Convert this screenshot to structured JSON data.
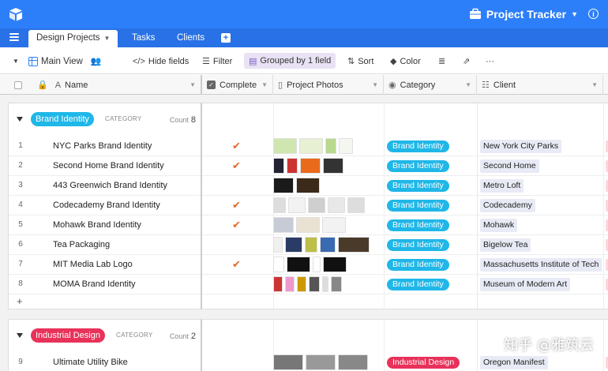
{
  "app": {
    "title": "Project Tracker",
    "brand_color": "#2d7ff9",
    "tabbar_color": "#2871e6"
  },
  "tabs": [
    {
      "label": "Design Projects",
      "active": true
    },
    {
      "label": "Tasks",
      "active": false
    },
    {
      "label": "Clients",
      "active": false
    }
  ],
  "viewbar": {
    "view_name": "Main View",
    "hide_fields": "Hide fields",
    "filter": "Filter",
    "grouped": "Grouped by 1 field",
    "sort": "Sort",
    "color": "Color",
    "more": "···"
  },
  "columns": {
    "name": "Name",
    "complete": "Complete",
    "photos": "Project Photos",
    "category": "Category",
    "client": "Client"
  },
  "groups": [
    {
      "label": "Brand Identity",
      "category_tag": "CATEGORY",
      "count_label": "Count",
      "count": "8",
      "color": "#1fb7e8",
      "rows": [
        {
          "num": "1",
          "name": "NYC Parks Brand Identity",
          "complete": true,
          "category": "Brand Identity",
          "client": "New York City Parks"
        },
        {
          "num": "2",
          "name": "Second Home Brand Identity",
          "complete": true,
          "category": "Brand Identity",
          "client": "Second Home"
        },
        {
          "num": "3",
          "name": "443 Greenwich Brand Identity",
          "complete": false,
          "category": "Brand Identity",
          "client": "Metro Loft"
        },
        {
          "num": "4",
          "name": "Codecademy Brand Identity",
          "complete": true,
          "category": "Brand Identity",
          "client": "Codecademy"
        },
        {
          "num": "5",
          "name": "Mohawk Brand Identity",
          "complete": true,
          "category": "Brand Identity",
          "client": "Mohawk"
        },
        {
          "num": "6",
          "name": "Tea Packaging",
          "complete": false,
          "category": "Brand Identity",
          "client": "Bigelow Tea"
        },
        {
          "num": "7",
          "name": "MIT Media Lab Logo",
          "complete": true,
          "category": "Brand Identity",
          "client": "Massachusetts Institute of Tech"
        },
        {
          "num": "8",
          "name": "MOMA Brand Identity",
          "complete": false,
          "category": "Brand Identity",
          "client": "Museum of Modern Art"
        }
      ]
    },
    {
      "label": "Industrial Design",
      "category_tag": "CATEGORY",
      "count_label": "Count",
      "count": "2",
      "color": "#e8325a",
      "rows": [
        {
          "num": "9",
          "name": "Ultimate Utility Bike",
          "complete": false,
          "category": "Industrial Design",
          "client": "Oregon Manifest"
        }
      ]
    }
  ],
  "add_row_symbol": "+",
  "check_symbol": "✔",
  "watermark": "知乎 @雅筑云"
}
